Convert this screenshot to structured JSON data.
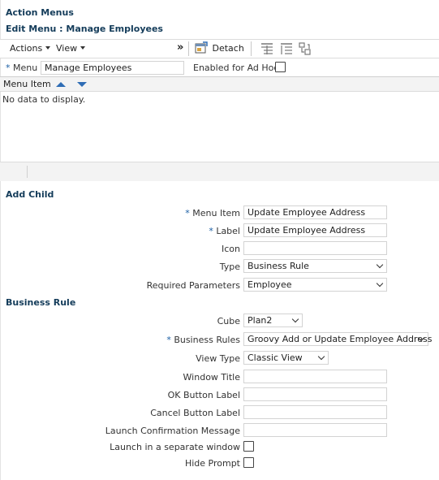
{
  "header": {
    "title": "Action Menus",
    "subtitle": "Edit Menu : Manage Employees"
  },
  "toolbar": {
    "actions_label": "Actions",
    "view_label": "View",
    "overflow_label": "»",
    "detach_label": "Detach"
  },
  "menu": {
    "required_mark": "*",
    "label": "Menu",
    "value": "Manage Employees",
    "adhoc_label": "Enabled for Ad Hoc",
    "adhoc_checked": false
  },
  "grid": {
    "column": "Menu Item",
    "empty_text": "No data to display."
  },
  "add_child": {
    "section_title": "Add Child",
    "menu_item_label": "Menu Item",
    "menu_item_value": "Update Employee Address",
    "label_label": "Label",
    "label_value": "Update Employee Address",
    "icon_label": "Icon",
    "icon_value": "",
    "type_label": "Type",
    "type_value": "Business Rule",
    "required_params_label": "Required Parameters",
    "required_params_value": "Employee"
  },
  "business_rule": {
    "section_title": "Business Rule",
    "cube_label": "Cube",
    "cube_value": "Plan2",
    "rules_label": "Business Rules",
    "rules_value": "Groovy Add or Update Employee Address",
    "view_type_label": "View Type",
    "view_type_value": "Classic View",
    "window_title_label": "Window Title",
    "window_title_value": "",
    "ok_label": "OK Button Label",
    "ok_value": "",
    "cancel_label": "Cancel Button Label",
    "cancel_value": "",
    "confirm_label": "Launch Confirmation Message",
    "confirm_value": "",
    "separate_window_label": "Launch in a separate window",
    "separate_window_checked": false,
    "hide_prompt_label": "Hide Prompt",
    "hide_prompt_checked": false
  },
  "colors": {
    "heading": "#143c5a",
    "required": "#1a5ea4",
    "sort_arrow": "#2f6db5"
  }
}
